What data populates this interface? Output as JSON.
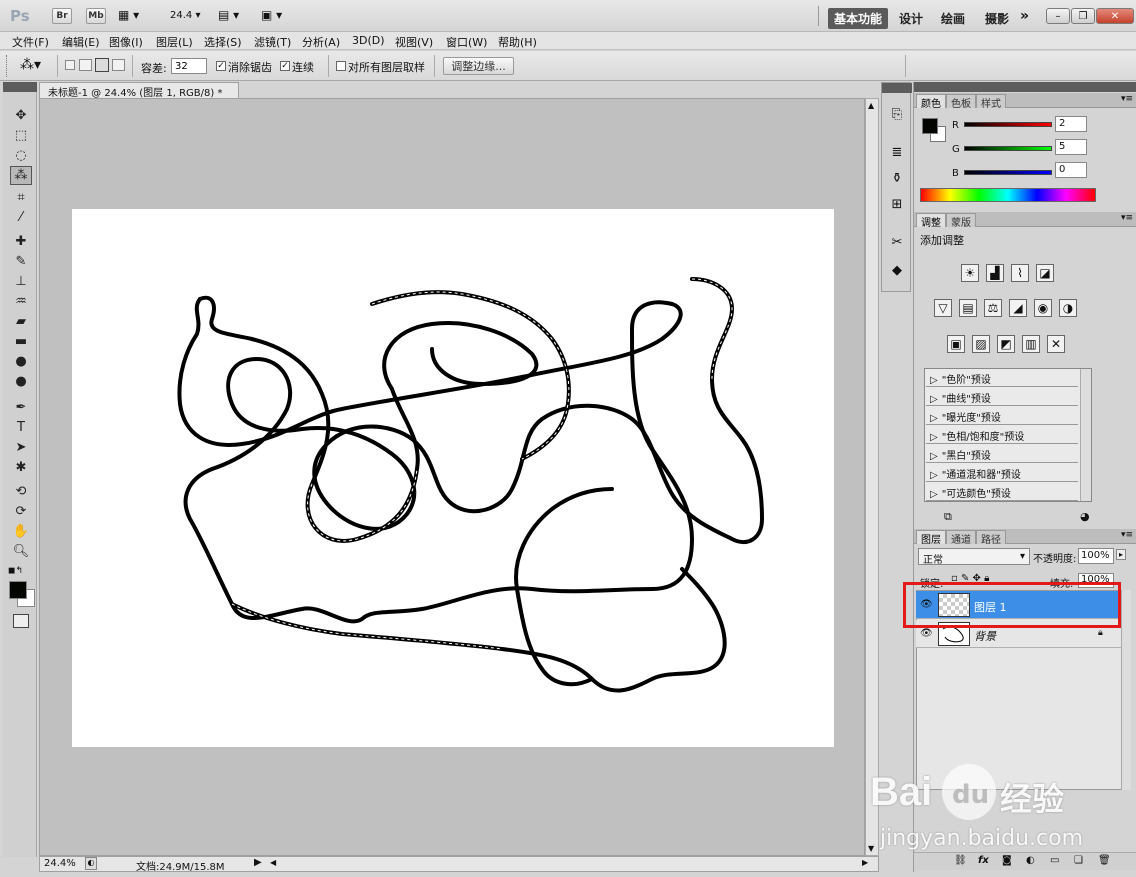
{
  "titlebar": {
    "logo": "Ps",
    "bridge": "Br",
    "minibridge": "Mb",
    "zoom_value": "24.4",
    "workspaces": [
      "基本功能",
      "设计",
      "绘画",
      "摄影"
    ],
    "more": "»"
  },
  "menu": [
    "文件(F)",
    "编辑(E)",
    "图像(I)",
    "图层(L)",
    "选择(S)",
    "滤镜(T)",
    "分析(A)",
    "3D(D)",
    "视图(V)",
    "窗口(W)",
    "帮助(H)"
  ],
  "options": {
    "tolerance_label": "容差:",
    "tolerance_value": "32",
    "antialias_label": "消除锯齿",
    "contiguous_label": "连续",
    "sample_all_label": "对所有图层取样",
    "refine_edge_button": "调整边缘..."
  },
  "document": {
    "tab_title": "未标题-1 @ 24.4% (图层 1, RGB/8) *",
    "close": "×",
    "status_zoom": "24.4%",
    "status_doc": "文档:24.9M/15.8M"
  },
  "color_panel": {
    "tabs": [
      "颜色",
      "色板",
      "样式"
    ],
    "r_label": "R",
    "g_label": "G",
    "b_label": "B",
    "r_value": "2",
    "g_value": "5",
    "b_value": "0",
    "fg_color": "#020500",
    "bg_color": "#ffffff"
  },
  "adjust_panel": {
    "tabs": [
      "调整",
      "蒙版"
    ],
    "title": "添加调整",
    "presets": [
      "\"色阶\"预设",
      "\"曲线\"预设",
      "\"曝光度\"预设",
      "\"色相/饱和度\"预设",
      "\"黑白\"预设",
      "\"通道混和器\"预设",
      "\"可选颜色\"预设"
    ]
  },
  "layers_panel": {
    "tabs": [
      "图层",
      "通道",
      "路径"
    ],
    "blend_mode": "正常",
    "opacity_label": "不透明度:",
    "opacity_value": "100%",
    "lock_label": "锁定:",
    "fill_label": "填充:",
    "fill_value": "100%",
    "layers": [
      {
        "name": "图层 1",
        "selected": true
      },
      {
        "name": "背景",
        "selected": false
      }
    ],
    "highlight_color": "#3d8ee6",
    "annotation_color": "#e31818"
  },
  "watermark": {
    "brand": "Bai",
    "paw_text": "du",
    "suffix": "经验",
    "url": "jingyan.baidu.com"
  }
}
